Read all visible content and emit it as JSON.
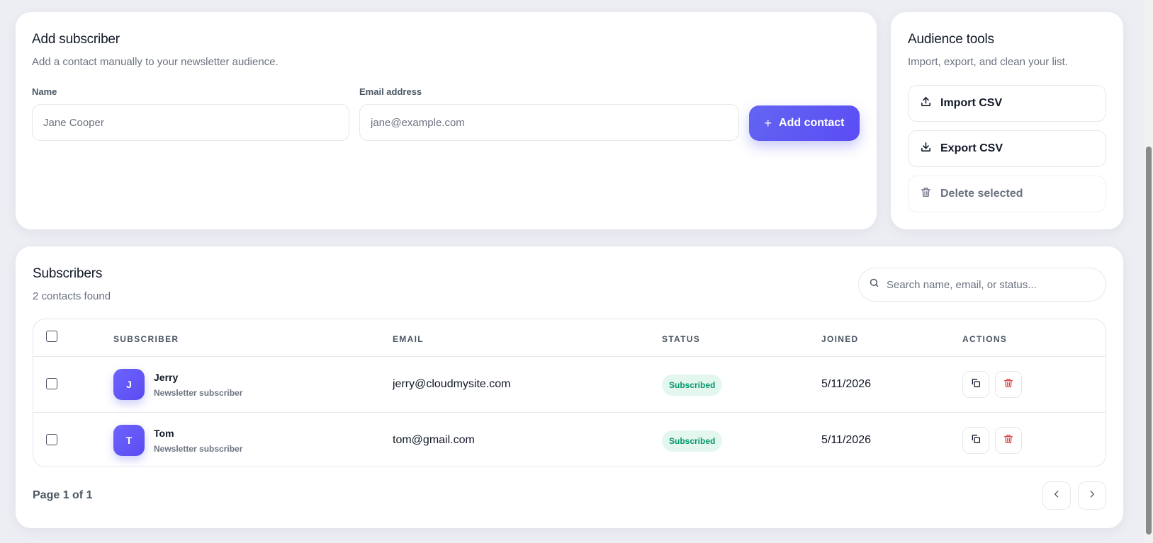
{
  "add_subscriber": {
    "title": "Add subscriber",
    "subtitle": "Add a contact manually to your newsletter audience.",
    "name_label": "Name",
    "name_placeholder": "Jane Cooper",
    "email_label": "Email address",
    "email_placeholder": "jane@example.com",
    "add_button_label": "Add contact"
  },
  "audience_tools": {
    "title": "Audience tools",
    "subtitle": "Import, export, and clean your list.",
    "import_label": "Import CSV",
    "export_label": "Export CSV",
    "delete_label": "Delete selected"
  },
  "subscribers": {
    "title": "Subscribers",
    "count_text": "2 contacts found",
    "search_placeholder": "Search name, email, or status...",
    "columns": [
      "SUBSCRIBER",
      "EMAIL",
      "STATUS",
      "JOINED",
      "ACTIONS"
    ],
    "rows": [
      {
        "initial": "J",
        "name": "Jerry",
        "role": "Newsletter subscriber",
        "email": "jerry@cloudmysite.com",
        "status": "Subscribed",
        "joined": "5/11/2026"
      },
      {
        "initial": "T",
        "name": "Tom",
        "role": "Newsletter subscriber",
        "email": "tom@gmail.com",
        "status": "Subscribed",
        "joined": "5/11/2026"
      }
    ],
    "page_info": "Page 1 of 1"
  },
  "icons": {
    "add": "plus-icon",
    "import": "upload-icon",
    "export": "download-icon",
    "delete": "trash-icon",
    "search": "search-icon",
    "copy": "copy-icon",
    "prev": "chevron-left-icon",
    "next": "chevron-right-icon"
  },
  "colors": {
    "accent": "#5b4cf5",
    "success_text": "#059669",
    "success_bg": "#e3f7ef",
    "danger": "#e04848"
  }
}
